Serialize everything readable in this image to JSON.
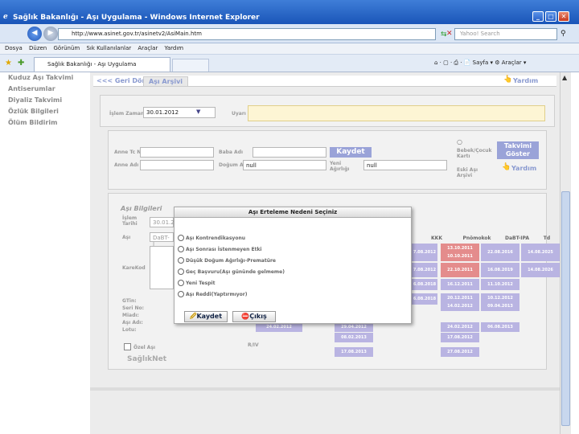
{
  "window": {
    "title": "Sağlık Bakanlığı - Aşı Uygulama - Windows Internet Explorer",
    "min": "_",
    "max": "□",
    "close": "✕"
  },
  "nav": {
    "url": "http://www.asinet.gov.tr/asinetv2/AsiMain.htm",
    "search_placeholder": "Yahoo! Search",
    "tools": "⌂ · ▢ · ⎙ · 📄 Sayfa ▾ ⚙ Araçlar ▾"
  },
  "menu": [
    "Dosya",
    "Düzen",
    "Görünüm",
    "Sık Kullanılanlar",
    "Araçlar",
    "Yardım"
  ],
  "tab": {
    "label": "Sağlık Bakanlığı - Aşı Uygulama"
  },
  "sidebar": {
    "items": [
      "Kuduz Aşı Takvimi",
      "Antiserumlar",
      "Diyaliz Takvimi",
      "Özlük Bilgileri",
      "Ölüm Bildirim"
    ]
  },
  "toolbar": {
    "back": "<<< Geri Dön",
    "archive": "Aşı Arşivi",
    "help": "Yardım"
  },
  "form": {
    "islem_label": "İşlem Zamanı",
    "islem_value": "30.01.2012",
    "uyari_label": "Uyarı :",
    "anne_tc": "Anne Tc No",
    "baba_adi": "Baba Adı",
    "anne_adi": "Anne Adı",
    "dogum_label": "Doğum Ağırlığı",
    "dogum_value": "null",
    "yeni_label": "Yeni Ağırlığı",
    "yeni_value": "null",
    "kaydet": "Kaydet",
    "bebek": "Bebek/Çocuk Kartı",
    "eski": "Eski Aşı Arşivi",
    "takvim": "Takvimi Göster",
    "yardim": "Yardım"
  },
  "asi": {
    "title": "Aşı Bilgileri",
    "islem_tarihi": "İşlem Tarihi",
    "islem_tarihi_val": "30.01.20",
    "asi_label": "Aşı",
    "asi_val": "DaBT-I",
    "karekod": "KareKod",
    "gtin": "GTin:",
    "seri": "Seri No:",
    "miadi": "Miadı:",
    "asi_adi": "Aşı Adı:",
    "lotu": "Lotu:",
    "ozel": "Özel Aşı",
    "saglik": "SağlıkNet",
    "riv": "R/IV"
  },
  "table": {
    "headers": [
      "KKK",
      "Pnömokok",
      "DaBT-IPA",
      "Td"
    ],
    "rows": [
      [
        "7.08.2012",
        "13.10.2011 10.10.2011",
        "22.08.2016",
        "14.08.2025"
      ],
      [
        "7.08.2012",
        "22.10.2011",
        "16.08.2019",
        "14.08.2026"
      ],
      [
        "6.08.2018",
        "16.12.2011",
        "11.10.2012",
        ""
      ],
      [
        "6.08.2018",
        "20.12.2011 14.02.2012",
        "10.12.2012 09.04.2013",
        ""
      ],
      [
        "",
        "24.02.2012",
        "06.08.2013",
        ""
      ],
      [
        "",
        "17.08.2012",
        "",
        ""
      ],
      [
        "",
        "27.08.2012",
        "",
        ""
      ]
    ],
    "left_cells": [
      "24.02.2012",
      "29.04.2012",
      "08.02.2013",
      "17.08.2013"
    ]
  },
  "dialog": {
    "title": "Aşı Erteleme Nedeni Seçiniz",
    "options": [
      "Aşı Kontrendikasyonu",
      "Aşı Sonrası İstenmeyen Etki",
      "Düşük Doğum Ağırlığı-Prematüre",
      "Geç Başvuru(Aşı gününde gelmeme)",
      "Yeni Tespit",
      "Aşı Reddi(Yaptırmıyor)"
    ],
    "save": "Kaydet",
    "exit": "Çıkış"
  },
  "colors": {
    "title_bar": "#1a55b8",
    "accent": "#9aa3d8",
    "cell": "#b9b4e2",
    "red_cell": "#e48c8c"
  }
}
